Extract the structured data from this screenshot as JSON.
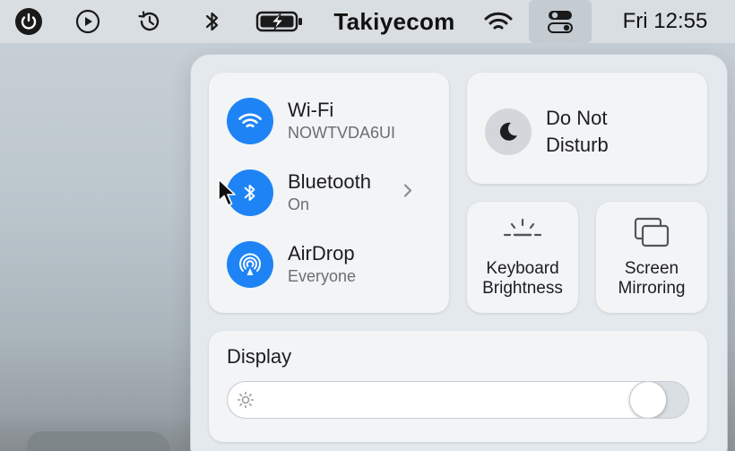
{
  "menubar": {
    "brand": "Takiyecom",
    "clock": "Fri 12:55",
    "icons": [
      "power-icon",
      "play-icon",
      "time-machine-icon",
      "bluetooth-icon",
      "battery-charging-icon",
      "wifi-icon",
      "control-center-icon"
    ]
  },
  "network": {
    "wifi": {
      "title": "Wi-Fi",
      "subtitle": "NOWTVDA6UI"
    },
    "bluetooth": {
      "title": "Bluetooth",
      "subtitle": "On"
    },
    "airdrop": {
      "title": "AirDrop",
      "subtitle": "Everyone"
    }
  },
  "dnd": {
    "line1": "Do Not",
    "line2": "Disturb"
  },
  "keyboard": {
    "line1": "Keyboard",
    "line2": "Brightness"
  },
  "mirroring": {
    "line1": "Screen",
    "line2": "Mirroring"
  },
  "display": {
    "title": "Display",
    "brightness": 0.95
  },
  "colors": {
    "accent": "#1e84f5",
    "panel": "#e4e9ed",
    "module": "#f2f4f6"
  }
}
